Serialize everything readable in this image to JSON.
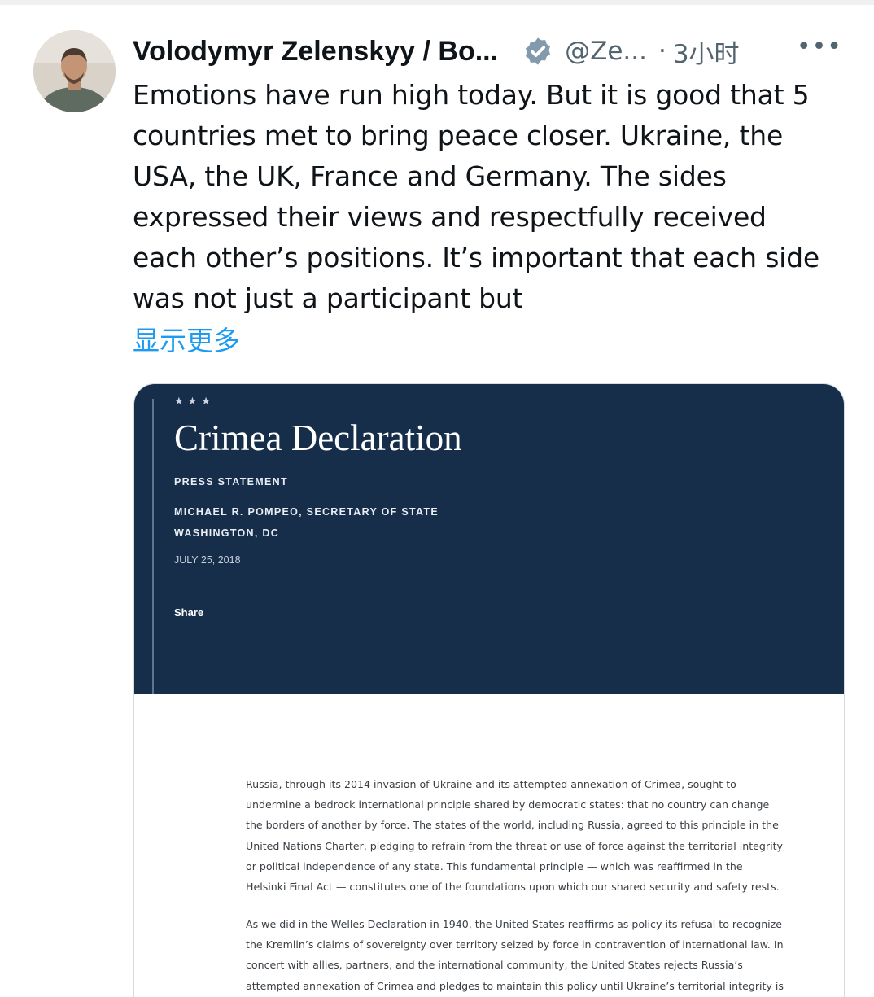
{
  "tweet": {
    "display_name": "Volodymyr Zelenskyy / Bo...",
    "handle": "@Ze...",
    "separator": "·",
    "time": "3小时",
    "more_icon": "•••",
    "lines": [
      "Emotions have run high today. But it is good that 5",
      "countries met to bring peace closer. Ukraine, the",
      "USA, the UK, France and Germany. The sides",
      "expressed their views and respectfully received",
      "each other’s positions. It’s important that each side",
      "was not just a participant but"
    ],
    "show_more": "显示更多"
  },
  "document": {
    "stars": "★★★",
    "title": "Crimea Declaration",
    "label": "PRESS STATEMENT",
    "author": "MICHAEL R. POMPEO, SECRETARY OF STATE",
    "location": "WASHINGTON, DC",
    "date": "JULY 25, 2018",
    "share": "Share",
    "paragraph1": [
      "Russia, through its 2014 invasion of Ukraine and its attempted annexation of Crimea, sought to",
      "undermine a bedrock international principle shared by democratic states: that no country can change",
      "the borders of another by force. The states of the world, including Russia, agreed to this principle in the",
      "United Nations Charter, pledging to refrain from the threat or use of force against the territorial integrity",
      "or political independence of any state. This fundamental principle — which was reaffirmed in the",
      "Helsinki Final Act — constitutes one of the foundations upon which our shared security and safety rests."
    ],
    "paragraph2": [
      "As we did in the Welles Declaration in 1940, the United States reaffirms as policy its refusal to recognize",
      "the Kremlin’s claims of sovereignty over territory seized by force in contravention of international law. In",
      "concert with allies, partners, and the international community, the United States rejects Russia’s",
      "attempted annexation of Crimea and pledges to maintain this policy until Ukraine’s territorial integrity is"
    ]
  },
  "colors": {
    "hero_background": "#162e4a",
    "link_blue": "#1d9bf0",
    "muted_gray": "#536471"
  }
}
